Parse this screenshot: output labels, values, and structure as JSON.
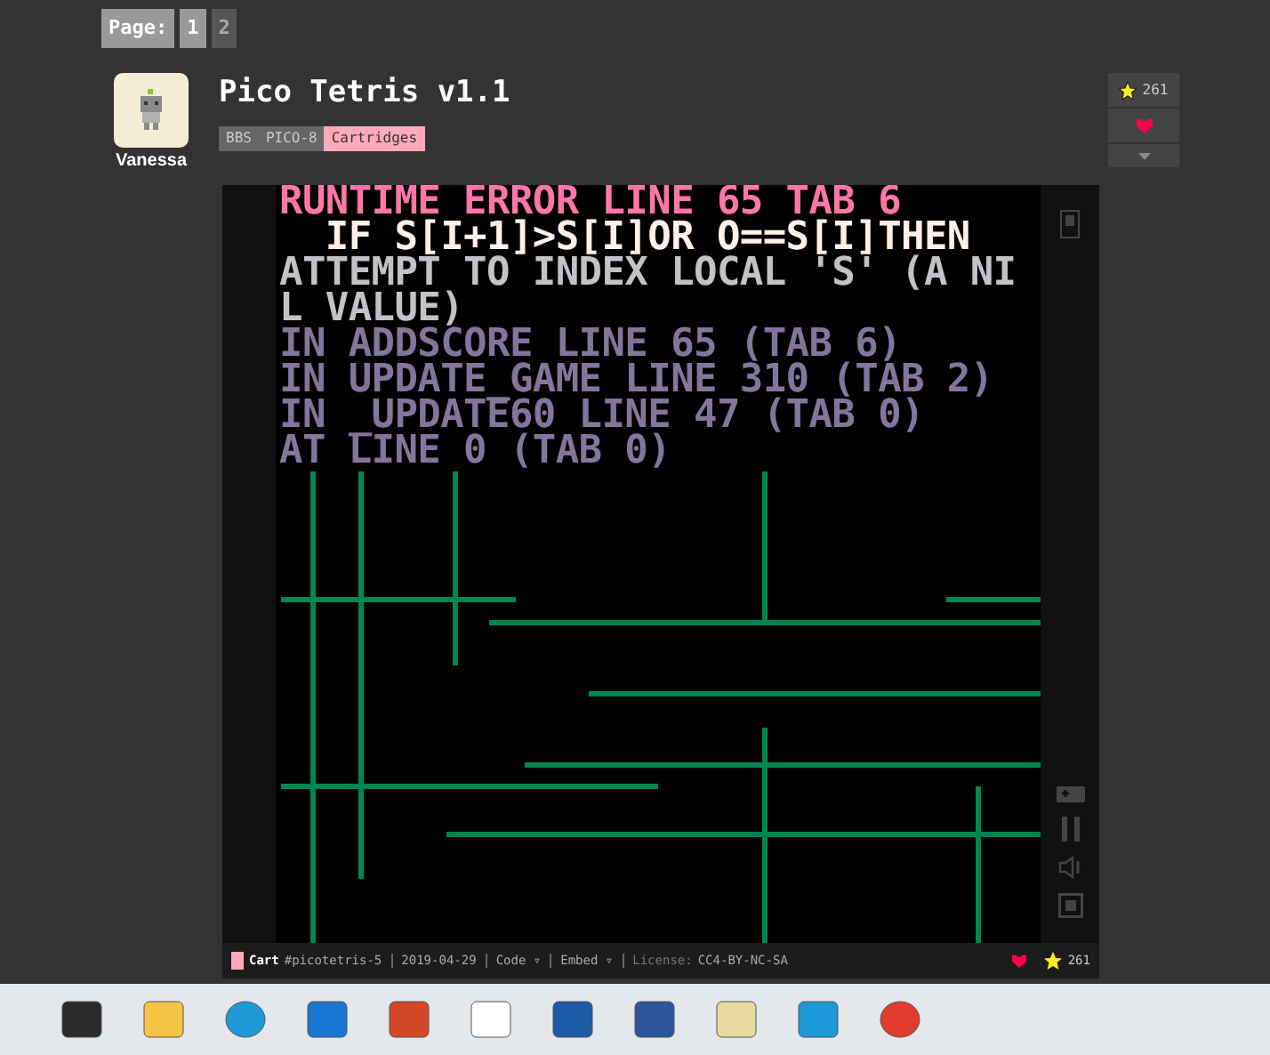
{
  "pager": {
    "label": "Page:",
    "pages": [
      {
        "label": "1",
        "selected": true
      },
      {
        "label": "2",
        "selected": false
      }
    ]
  },
  "author": {
    "name": "Vanessa"
  },
  "post": {
    "title": "Pico Tetris v1.1",
    "breadcrumbs": [
      {
        "label": "BBS",
        "selected": false
      },
      {
        "label": "PICO-8",
        "selected": false
      },
      {
        "label": "Cartridges",
        "selected": true
      }
    ]
  },
  "votes": {
    "stars": "261"
  },
  "console": [
    {
      "text": "RUNTIME ERROR LINE 65 TAB 6",
      "color": "#ff77a8"
    },
    {
      "text": "  IF S[I+1]>S[I]OR O==S[I]THEN",
      "color": "#fff1e8"
    },
    {
      "text": "ATTEMPT TO INDEX LOCAL 'S' (A NI",
      "color": "#c2c3c7"
    },
    {
      "text": "L VALUE)",
      "color": "#c2c3c7"
    },
    {
      "text": "IN ADDSCORE LINE 65 (TAB 6)",
      "color": "#83769c"
    },
    {
      "text": "IN UPDATE_GAME LINE 310 (TAB 2)",
      "color": "#83769c"
    },
    {
      "text": "IN _UPDATE60 LINE 47 (TAB 0)",
      "color": "#83769c"
    },
    {
      "text": "AT LINE 0 (TAB 0)",
      "color": "#83769c"
    }
  ],
  "cart_bar": {
    "label": "Cart",
    "id": "#picotetris-5",
    "date": "2019-04-29",
    "code": "Code ▿",
    "embed": "Embed ▿",
    "license_label": "License:",
    "license": "CC4-BY-NC-SA",
    "stars": "261"
  }
}
